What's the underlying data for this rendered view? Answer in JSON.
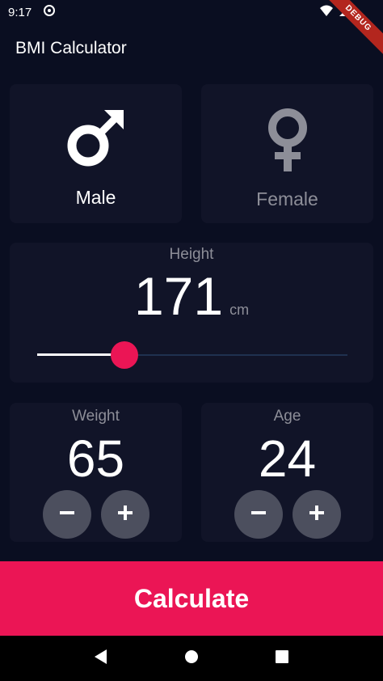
{
  "status_bar": {
    "time": "9:17",
    "debug_label": "DEBUG"
  },
  "app_bar": {
    "title": "BMI Calculator"
  },
  "gender": {
    "male": {
      "label": "Male",
      "icon": "male-icon"
    },
    "female": {
      "label": "Female",
      "icon": "female-icon"
    }
  },
  "height": {
    "label": "Height",
    "value": "171",
    "unit": "cm",
    "slider_fraction": 0.28
  },
  "weight": {
    "label": "Weight",
    "value": "65"
  },
  "age": {
    "label": "Age",
    "value": "24"
  },
  "calculate": {
    "label": "Calculate"
  },
  "colors": {
    "background": "#0a0e21",
    "card": "#111428",
    "accent": "#eb1555",
    "inactive_text": "#8d8e98",
    "round_button": "#4c4f5e"
  }
}
